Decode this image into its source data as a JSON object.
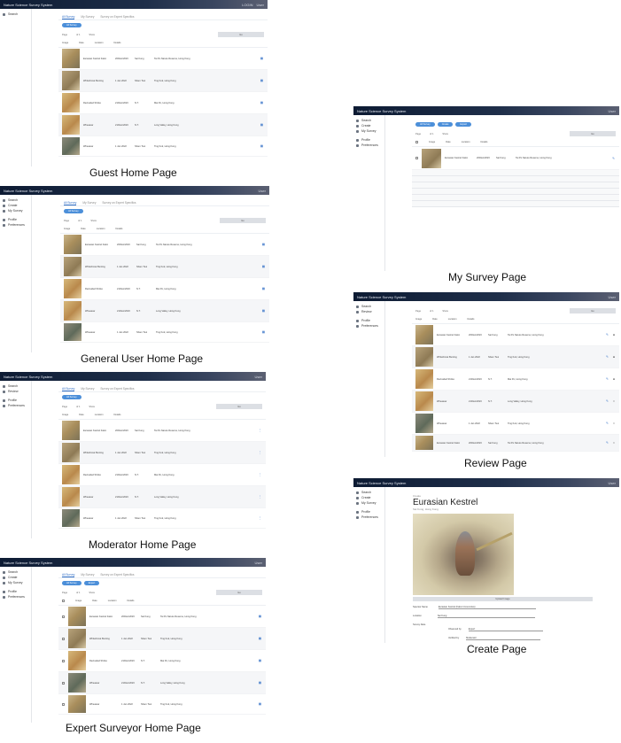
{
  "app": {
    "title": "Nature Science Survey System"
  },
  "nav": {
    "search": "Search",
    "create": "Create",
    "my_survey": "My Survey",
    "profile": "Profile",
    "preferences": "Preferences",
    "review": "Review"
  },
  "tabs": [
    "All Survey",
    "My Survey",
    "Survey on Expert Specifics"
  ],
  "filters": {
    "page": "Page",
    "of": "of 1",
    "show": "Show",
    "go": "Go"
  },
  "columns": [
    "Image",
    "Date",
    "Location",
    "Details"
  ],
  "rows": [
    {
      "name": "Eurasian Kestrel Falco",
      "date": "20/Dec/2023",
      "loc": "Sai Kung",
      "detail": "Tai Po Nature Reserve, Hong Kong"
    },
    {
      "name": "Whitethroat Bunting",
      "date": "1 Jan 2022",
      "loc": "Sham Tsui",
      "detail": "Ting Kok, Hong Kong"
    },
    {
      "name": "Red-tailed Shrike",
      "date": "21/Dec/2023",
      "loc": "N.T.",
      "detail": "Mai Po, Hong Kong"
    },
    {
      "name": "Wheatear",
      "date": "21/Dec/2023",
      "loc": "N.T.",
      "detail": "Long Valley, Hong Kong"
    },
    {
      "name": "Wheatear",
      "date": "1 Jan 2022",
      "loc": "Sham Tsui",
      "detail": "Ting Kok, Hong Kong"
    }
  ],
  "pills": {
    "all": "All Survey",
    "my": "Create",
    "ex": "Expert"
  },
  "captions": {
    "guest": "Guest Home Page",
    "general": "General User Home Page",
    "moderator": "Moderator Home Page",
    "expert": "Expert Surveyor Home Page",
    "my_survey": "My Survey Page",
    "review": "Review Page",
    "create": "Create Page"
  },
  "create": {
    "breadcrumb": "Create",
    "title": "Eurasian Kestrel",
    "subtitle": "Sai Kung, Hong Kong",
    "button": "Upload Image",
    "f1": "Species Name",
    "f1v": "Eurasian Kestrel (Falco tinnunculus)",
    "f2": "Location",
    "f2v": "Sai Kung",
    "f3": "Survey Date",
    "f4": "Observed by",
    "f4v": "Expert",
    "f5": "Verified by",
    "f5v": "Moderator"
  },
  "user": {
    "login": "LOGIN",
    "name": "User"
  }
}
